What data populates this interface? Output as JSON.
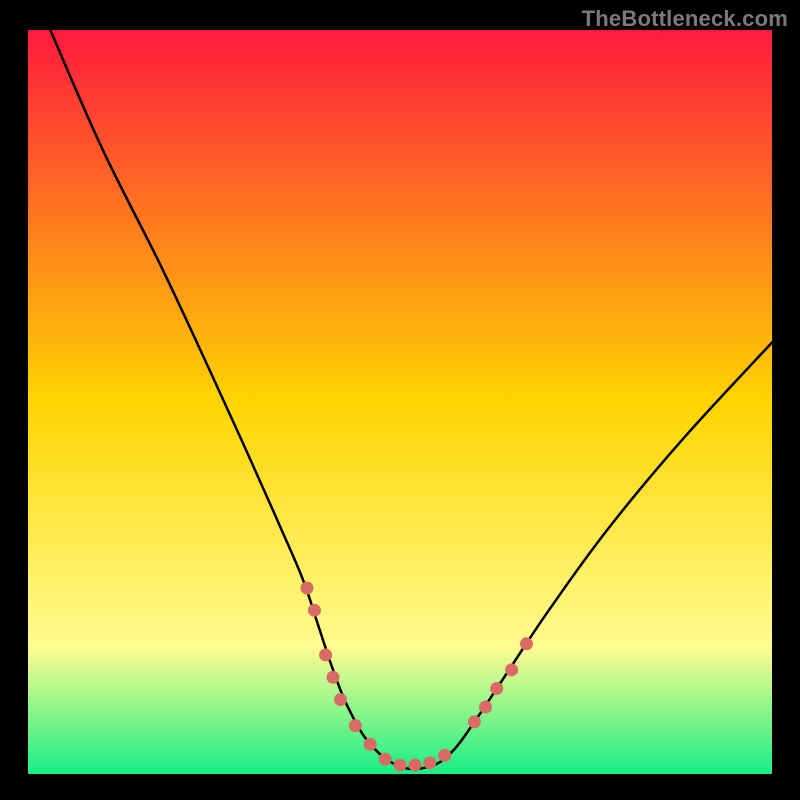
{
  "watermark": "TheBottleneck.com",
  "colors": {
    "frame": "#000000",
    "curve": "#000000",
    "marker": "#d96a64",
    "gradient_top": "#ff1a3e",
    "gradient_mid": "#ffd400",
    "gradient_band": "#fffc90",
    "gradient_bottom": "#17ef86"
  },
  "chart_data": {
    "type": "line",
    "title": "",
    "xlabel": "",
    "ylabel": "",
    "xlim": [
      0,
      100
    ],
    "ylim": [
      0,
      100
    ],
    "curve": {
      "x": [
        3,
        10,
        18,
        25,
        30,
        34,
        37,
        39,
        41,
        43,
        46,
        50,
        54,
        57,
        60,
        64,
        70,
        78,
        88,
        100
      ],
      "y": [
        100,
        84,
        68,
        53,
        42,
        33,
        26,
        20,
        14,
        9,
        4,
        1,
        1,
        3,
        7,
        13,
        22,
        33,
        45,
        58
      ]
    },
    "markers": {
      "x": [
        37.5,
        38.5,
        40.0,
        41.0,
        42.0,
        44.0,
        46.0,
        48.0,
        50.0,
        52.0,
        54.0,
        56.0,
        60.0,
        61.5,
        63.0,
        65.0,
        67.0
      ],
      "y": [
        25.0,
        22.0,
        16.0,
        13.0,
        10.0,
        6.5,
        4.0,
        2.0,
        1.2,
        1.2,
        1.5,
        2.5,
        7.0,
        9.0,
        11.5,
        14.0,
        17.5
      ]
    }
  }
}
